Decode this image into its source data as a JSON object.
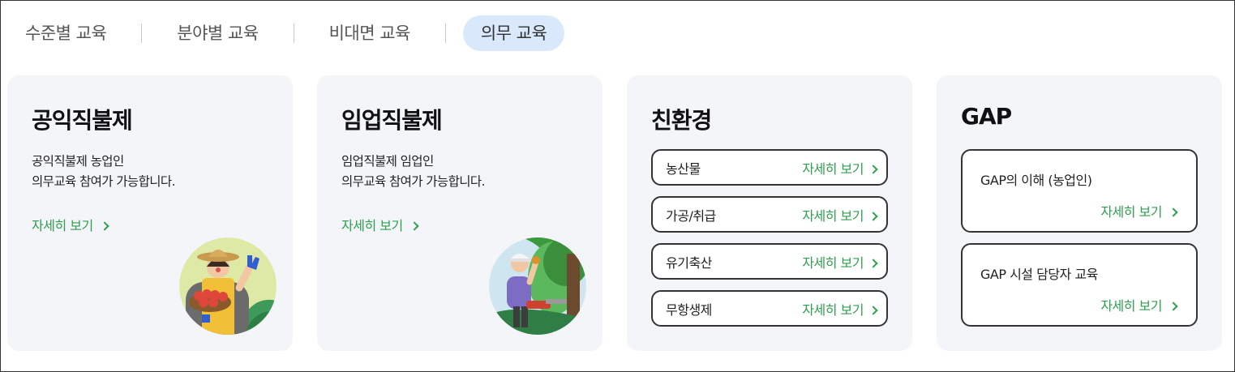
{
  "tabs": [
    {
      "label": "수준별 교육"
    },
    {
      "label": "분야별 교육"
    },
    {
      "label": "비대면 교육"
    },
    {
      "label": "의무 교육",
      "active": true
    }
  ],
  "colors": {
    "accent": "#2e9e4f",
    "tab_active_bg": "#d9e9fb",
    "card_bg": "#f4f5f9"
  },
  "cards": [
    {
      "title": "공익직불제",
      "desc_line1": "공익직불제 농업인",
      "desc_line2": "의무교육 참여가 가능합니다.",
      "more": "자세히 보기",
      "illustration": "farmer-illustration"
    },
    {
      "title": "임업직불제",
      "desc_line1": "임업직불제 임업인",
      "desc_line2": "의무교육 참여가 가능합니다.",
      "more": "자세히 보기",
      "illustration": "forester-illustration"
    },
    {
      "title": "친환경",
      "items": [
        {
          "label": "농산물",
          "link": "자세히 보기"
        },
        {
          "label": "가공/취급",
          "link": "자세히 보기"
        },
        {
          "label": "유기축산",
          "link": "자세히 보기"
        },
        {
          "label": "무항생제",
          "link": "자세히 보기"
        }
      ]
    },
    {
      "title": "GAP",
      "items": [
        {
          "label": "GAP의 이해 (농업인)",
          "link": "자세히 보기"
        },
        {
          "label": "GAP 시설 담당자 교육",
          "link": "자세히 보기"
        }
      ]
    }
  ]
}
